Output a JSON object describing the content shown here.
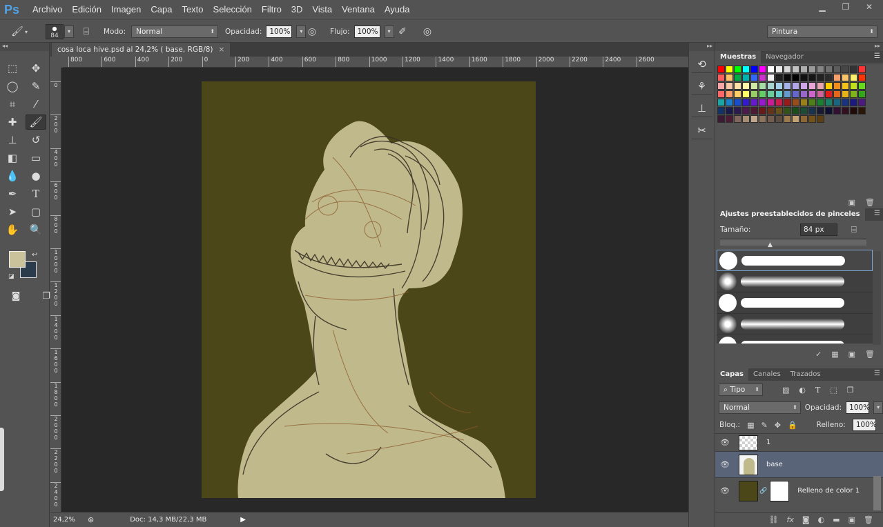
{
  "app": {
    "logo": "Ps"
  },
  "menu": [
    "Archivo",
    "Edición",
    "Imagen",
    "Capa",
    "Texto",
    "Selección",
    "Filtro",
    "3D",
    "Vista",
    "Ventana",
    "Ayuda"
  ],
  "window_controls": [
    "▁",
    "❐",
    "✕"
  ],
  "options": {
    "brush_size": "84",
    "mode_label": "Modo:",
    "mode_value": "Normal",
    "opacity_label": "Opacidad:",
    "opacity_value": "100%",
    "flow_label": "Flujo:",
    "flow_value": "100%",
    "workspace": "Pintura"
  },
  "document": {
    "tab_title": "cosa loca hive.psd al 24,2% ( base, RGB/8)",
    "tab_close": "×",
    "zoom": "24,2%",
    "doc_info": "Doc: 14,3 MB/22,3 MB"
  },
  "ruler": {
    "h": [
      "800",
      "600",
      "400",
      "200",
      "0",
      "200",
      "400",
      "600",
      "800",
      "1000",
      "1200",
      "1400",
      "1600",
      "1800",
      "2000",
      "2200",
      "2400",
      "2600"
    ],
    "v": [
      "0",
      "200",
      "400",
      "600",
      "800",
      "1000",
      "1200",
      "1400",
      "1600",
      "1800",
      "2000",
      "2200",
      "2400"
    ]
  },
  "colors": {
    "foreground": "#c9c29b",
    "background": "#2a3b4c",
    "canvas": "#4b4719",
    "figure": "#c0b98c"
  },
  "swatches_panel": {
    "tabs": [
      "Muestras",
      "Navegador"
    ],
    "colors": [
      "#ff0000",
      "#ffff00",
      "#00ff00",
      "#00ffff",
      "#0000ff",
      "#ff00ff",
      "#ffffff",
      "#ebebeb",
      "#d6d6d6",
      "#c2c2c2",
      "#adadad",
      "#999999",
      "#858585",
      "#707070",
      "#5c5c5c",
      "#474747",
      "#333333",
      "#ff3333",
      "#ff5c5c",
      "#ffc266",
      "#00aa44",
      "#00b3b3",
      "#3366ff",
      "#cc33cc",
      "#f2f2f2",
      "#1f1f1f",
      "#0a0a0a",
      "#000000",
      "#111111",
      "#161616",
      "#222222",
      "#2b2b2b",
      "#f7a06b",
      "#f7c56b",
      "#fff06b",
      "#ff3300",
      "#f6a6a6",
      "#f7c6a6",
      "#fde0a6",
      "#fff7a6",
      "#cfe8a6",
      "#a6dca6",
      "#a6d6cf",
      "#a6d0e8",
      "#a6b3e8",
      "#b3a6e8",
      "#d0a6e8",
      "#e8a6d6",
      "#e8a6b3",
      "#ffcc00",
      "#f28c1a",
      "#f2c21a",
      "#c2e01a",
      "#66d91a",
      "#ff6666",
      "#ff9966",
      "#ffcc66",
      "#ffff66",
      "#99cc66",
      "#66cc66",
      "#66cc99",
      "#66cccc",
      "#6699cc",
      "#6666cc",
      "#9966cc",
      "#cc66cc",
      "#cc6699",
      "#e61a1a",
      "#e6661a",
      "#e6b31a",
      "#80b31a",
      "#33a61a",
      "#1aa6a6",
      "#1a80cc",
      "#1a4dcc",
      "#331acc",
      "#661acc",
      "#991acc",
      "#cc1a99",
      "#cc1a4d",
      "#991a1a",
      "#994d1a",
      "#998019",
      "#4d8019",
      "#1a8033",
      "#1a8066",
      "#1a6680",
      "#1a3380",
      "#1a1a80",
      "#4d1a80",
      "#133366",
      "#1a1a4d",
      "#2b1a4d",
      "#4d1a4d",
      "#4d1a33",
      "#661a1a",
      "#663319",
      "#665219",
      "#335219",
      "#1a4d1a",
      "#1a4d33",
      "#1a334d",
      "#1a1a33",
      "#0f0f33",
      "#330f33",
      "#33101f",
      "#200a0a",
      "#2a1606",
      "#3d1a33",
      "#4d1a33",
      "#80665c",
      "#a68c73",
      "#bfa68c",
      "#8c735c",
      "#735c4d",
      "#5c4d40",
      "#9c7a4d",
      "#c2a273",
      "#8c6633",
      "#735219",
      "#5c4013"
    ]
  },
  "brush_panel": {
    "title": "Ajustes preestablecidos de pinceles",
    "size_label": "Tamaño:",
    "size_value": "84 px"
  },
  "layers_panel": {
    "tabs": [
      "Capas",
      "Canales",
      "Trazados"
    ],
    "filter": "Tipo",
    "blend": "Normal",
    "opacity_label": "Opacidad:",
    "opacity_value": "100%",
    "lock_label": "Bloq.:",
    "fill_label": "Relleno:",
    "fill_value": "100%",
    "layers": [
      {
        "name": "1",
        "selected": false
      },
      {
        "name": "base",
        "selected": true
      },
      {
        "name": "Relleno de color 1",
        "selected": false
      }
    ]
  }
}
